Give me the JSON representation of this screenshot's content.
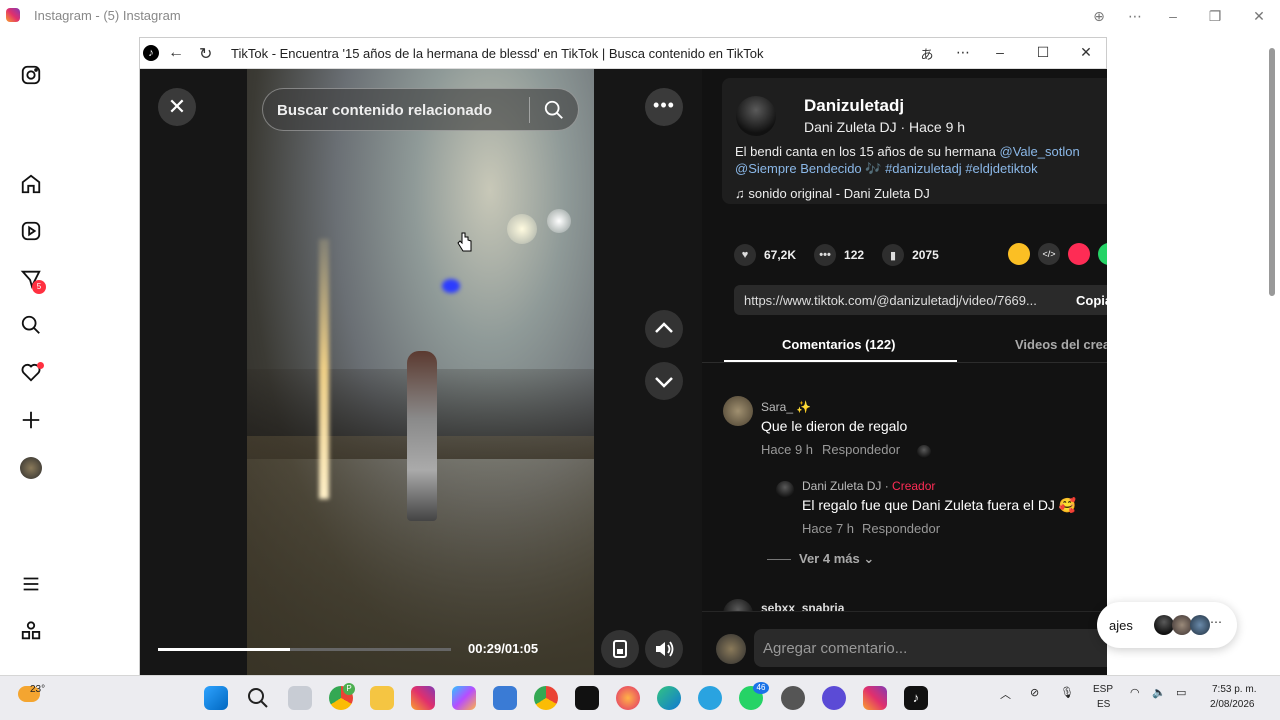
{
  "instagram": {
    "window_title": "Instagram - (5) Instagram",
    "notifications_badge": "5"
  },
  "tiktok": {
    "window_title": "TikTok - Encuentra '15 años de la hermana de blessd' en TikTok | Busca contenido en TikTok",
    "search_placeholder": "Buscar contenido relacionado",
    "video_time": "00:29/01:05",
    "progress_percent": 45,
    "author": {
      "name": "Danizuletadj",
      "subtitle": "Dani  Zuleta  DJ · Hace 9 h"
    },
    "description": {
      "text": "El bendi canta en los 15 años de su hermana ",
      "mention1": "@Vale_sotlon",
      "mention2": "@Siempre Bendecido",
      "emoji": " 🎶 ",
      "tag1": "#danizuletadj",
      "tag2": "#eldjdetiktok"
    },
    "sound": "♫  sonido original - Dani  Zuleta  DJ",
    "stats": {
      "likes": "67,2K",
      "comments": "122",
      "saves": "2075"
    },
    "url": "https://www.tiktok.com/@danizuletadj/video/7669...",
    "copy_label": "Copia",
    "tabs": {
      "comments": "Comentarios (122)",
      "creator_videos": "Videos del crea"
    },
    "comments": [
      {
        "user": "Sara_ ✨",
        "text": "Que le dieron de regalo",
        "time": "Hace 9 h",
        "reply_label": "Respondedor"
      }
    ],
    "reply": {
      "user": "Dani Zuleta DJ · ",
      "creator_tag": "Creador",
      "text": "El regalo fue que Dani Zuleta fuera el DJ 🥰",
      "time": "Hace 7 h",
      "reply_label": "Respondedor"
    },
    "more_replies": "Ver 4 más",
    "next_user": "sebxx_snabria",
    "comment_placeholder": "Agregar comentario..."
  },
  "messages_pill": {
    "label": "ajes"
  },
  "taskbar": {
    "weather": "23°",
    "language": "ESP",
    "language_sub": "ES",
    "time": "7:53 p. m.",
    "date": "2/08/2026",
    "whatsapp_badge": "46",
    "chrome_badge": "P"
  },
  "colors": {
    "tiktok_red": "#fe2c55",
    "link_blue": "#8bb8e8",
    "dark_bg": "#121212"
  }
}
